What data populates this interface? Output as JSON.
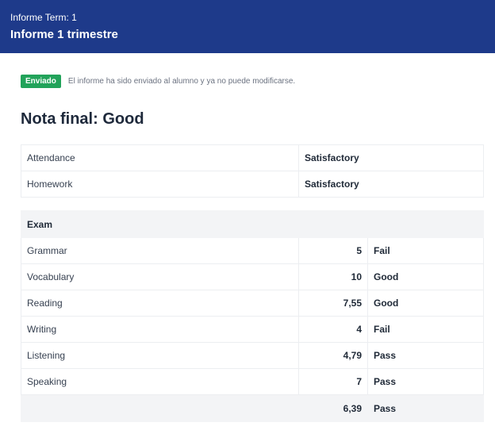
{
  "header": {
    "subtitle": "Informe Term: 1",
    "title": "Informe 1 trimestre"
  },
  "notice": {
    "badge": "Enviado",
    "text": "El informe ha sido enviado al alumno y ya no puede modificarse."
  },
  "final_grade": "Nota final: Good",
  "summary": [
    {
      "label": "Attendance",
      "value": "Satisfactory"
    },
    {
      "label": "Homework",
      "value": "Satisfactory"
    }
  ],
  "exam": {
    "heading": "Exam",
    "rows": [
      {
        "label": "Grammar",
        "score": "5",
        "result": "Fail"
      },
      {
        "label": "Vocabulary",
        "score": "10",
        "result": "Good"
      },
      {
        "label": "Reading",
        "score": "7,55",
        "result": "Good"
      },
      {
        "label": "Writing",
        "score": "4",
        "result": "Fail"
      },
      {
        "label": "Listening",
        "score": "4,79",
        "result": "Pass"
      },
      {
        "label": "Speaking",
        "score": "7",
        "result": "Pass"
      }
    ],
    "total": {
      "score": "6,39",
      "result": "Pass"
    }
  }
}
